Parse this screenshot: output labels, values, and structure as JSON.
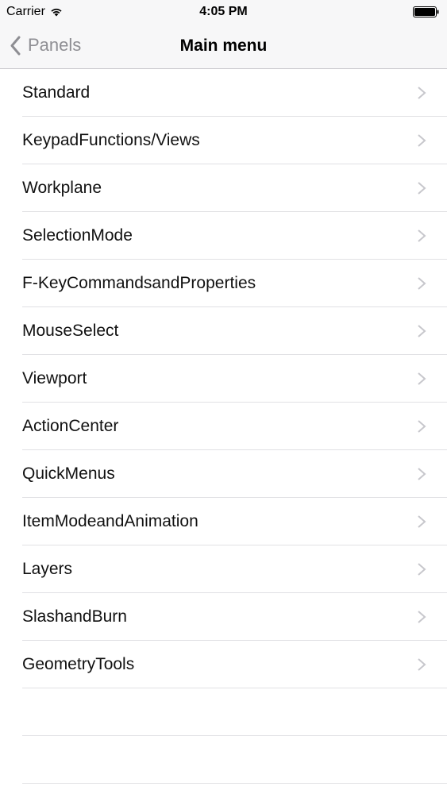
{
  "status_bar": {
    "carrier": "Carrier",
    "time": "4:05 PM",
    "wifi_icon": "wifi-icon",
    "battery_icon": "battery-icon"
  },
  "nav_bar": {
    "back_label": "Panels",
    "title": "Main menu",
    "back_icon": "chevron-left-icon",
    "tint_color": "#8e8e93"
  },
  "menu": {
    "items": [
      {
        "label": "Standard"
      },
      {
        "label": "KeypadFunctions/Views"
      },
      {
        "label": "Workplane"
      },
      {
        "label": "SelectionMode"
      },
      {
        "label": "F-KeyCommandsandProperties"
      },
      {
        "label": "MouseSelect"
      },
      {
        "label": "Viewport"
      },
      {
        "label": "ActionCenter"
      },
      {
        "label": "QuickMenus"
      },
      {
        "label": "ItemModeandAnimation"
      },
      {
        "label": "Layers"
      },
      {
        "label": "SlashandBurn"
      },
      {
        "label": "GeometryTools"
      }
    ],
    "disclosure_icon": "chevron-right-icon",
    "separator_color": "#e1e1e4",
    "chevron_color": "#c7c7cc"
  }
}
